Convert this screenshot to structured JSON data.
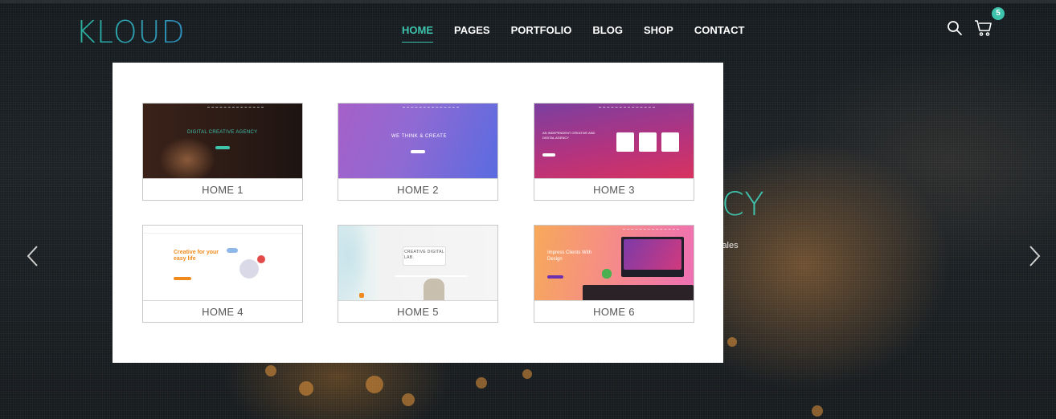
{
  "brand": {
    "logo_text": "KLOUD"
  },
  "nav": {
    "items": [
      {
        "label": "HOME",
        "active": true
      },
      {
        "label": "PAGES",
        "active": false
      },
      {
        "label": "PORTFOLIO",
        "active": false
      },
      {
        "label": "BLOG",
        "active": false
      },
      {
        "label": "SHOP",
        "active": false
      },
      {
        "label": "CONTACT",
        "active": false
      }
    ]
  },
  "header_icons": {
    "search": "search-icon",
    "cart": "cart-icon",
    "cart_count": "5"
  },
  "hero": {
    "title_fragment": "CY",
    "subtitle_fragment": "lales"
  },
  "mega_menu": {
    "cards": [
      {
        "label": "HOME 1",
        "thumb_text": "DIGITAL CREATIVE AGENCY"
      },
      {
        "label": "HOME 2",
        "thumb_text": "WE THINK & CREATE"
      },
      {
        "label": "HOME 3",
        "thumb_text": "AN INDEPENDENT CREATIVE AND DIGITAL AGENCY"
      },
      {
        "label": "HOME 4",
        "thumb_text": "Creative for your easy life"
      },
      {
        "label": "HOME 5",
        "thumb_text": "CREATIVE DIGITAL LAB."
      },
      {
        "label": "HOME 6",
        "thumb_text": "Impress Clients With Design"
      }
    ]
  },
  "colors": {
    "accent": "#3ec3ad",
    "menu_bg": "#ffffff"
  }
}
